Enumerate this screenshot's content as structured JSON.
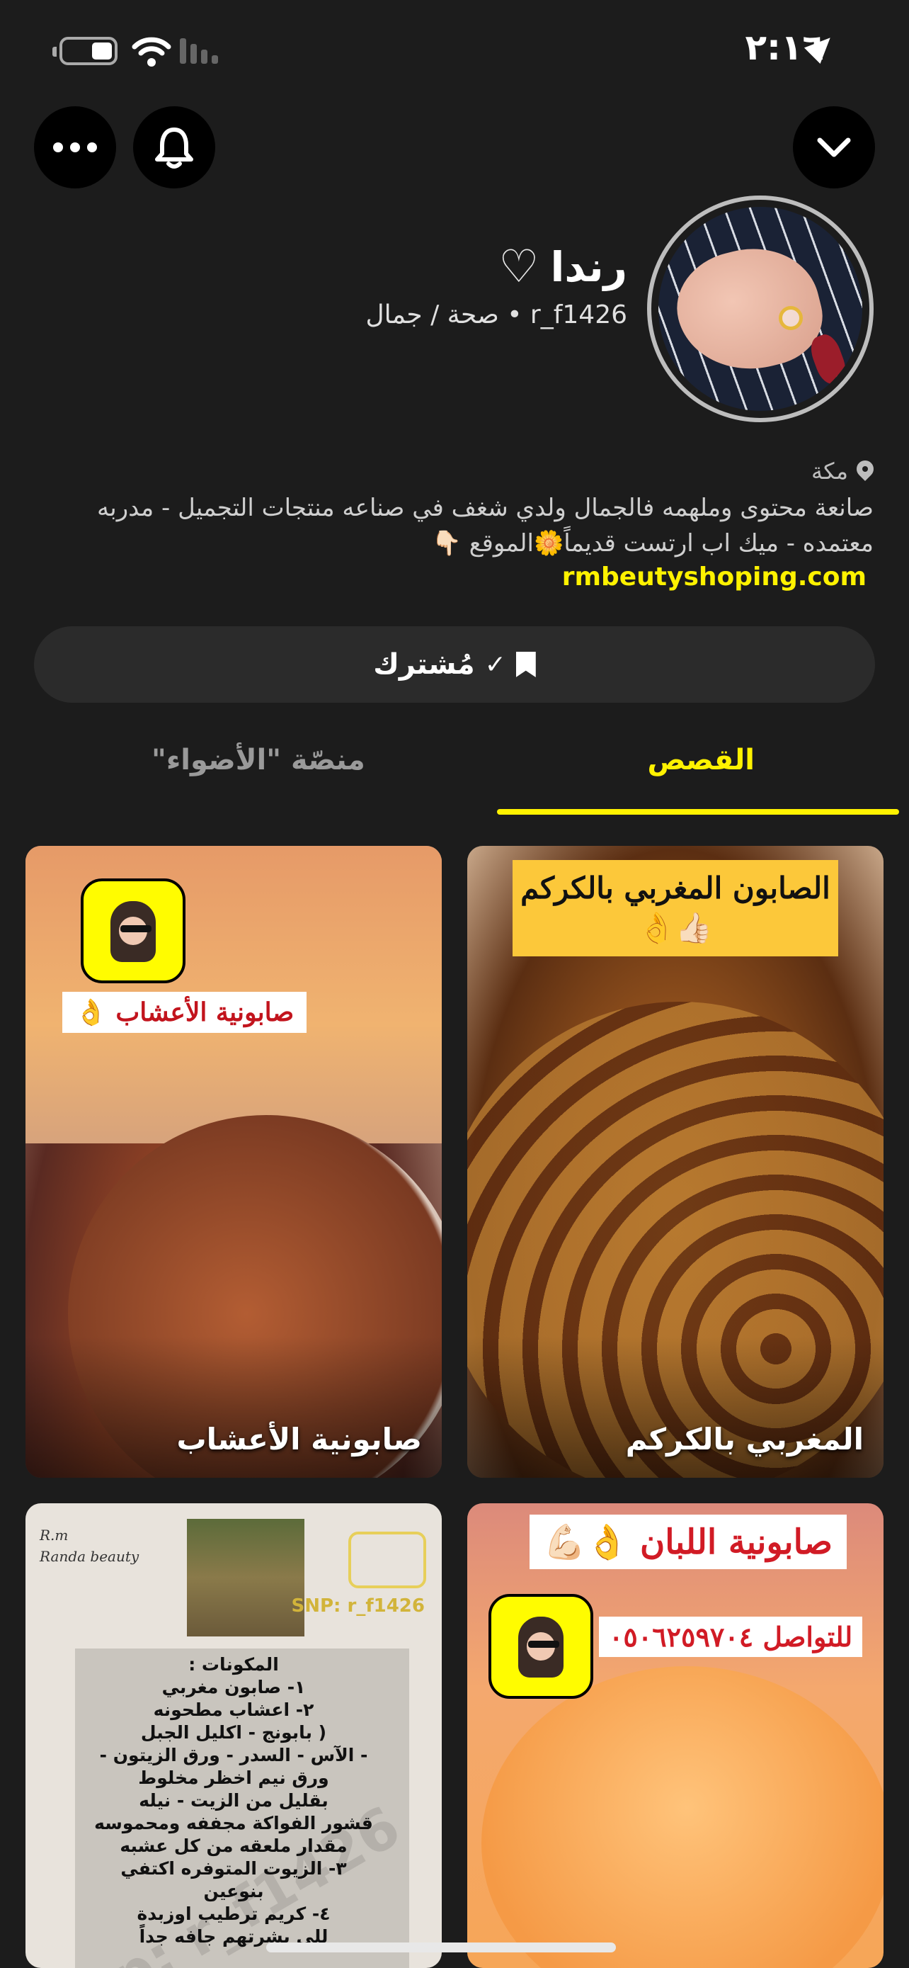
{
  "status_bar": {
    "time": "٢:١٦",
    "icons": [
      "location-arrow-icon",
      "battery-icon",
      "wifi-icon",
      "cellular-signal-icon"
    ]
  },
  "top_bar": {
    "icons": [
      "more-icon",
      "bell-icon",
      "chevron-down-icon"
    ]
  },
  "profile": {
    "name": "رندا",
    "name_emoji": "♡",
    "handle_line": "r_f1426 • صحة / جمال",
    "location": "مكة",
    "bio": "صانعة محتوى وملهمه فالجمال ولدي شغف في صناعه منتجات التجميل - مدربه معتمده - ميك اب ارتست قديماً🌼الموقع 👇🏻",
    "website": "rmbeutyshoping.com",
    "subscribe_label": "مُشترك",
    "subscribe_check": "✓"
  },
  "tabs": [
    {
      "label": "القصص",
      "active": true
    },
    {
      "label": "منصّة \"الأضواء\"",
      "active": false
    }
  ],
  "stories": [
    {
      "caption": "صابونية الأعشاب",
      "overlay_label": "صابونية الأعشاب 👌"
    },
    {
      "caption": "المغربي بالكركم",
      "overlay_label": "الصابون المغربي بالكركم 👍🏻👌"
    },
    {
      "logo_line1": "R.m",
      "logo_line2": "Randa beauty",
      "snap_label": "SNP: r_f1426",
      "recipe_lines": [
        "المكونات :",
        "١- صابون مغربي",
        "٢- اعشاب مطحونه",
        "( بابونج - اكليل الجبل",
        "- الآس - السدر - ورق الزيتون -",
        "ورق نيم اخظر مخلوط",
        "بقليل من الزيت - نيله",
        "قشور الفواكة مجففه ومحموسه",
        "مقدار ملعقه من كل عشبه",
        "٣- الزيوت المتوفره اكتفي",
        "بنوعين",
        "٤- كريم ترطيب اوزبدة",
        "للي بشرتهم جافه جداً"
      ],
      "watermark": "snp: r_f1426"
    },
    {
      "title": "صابونية اللبان 👌💪🏻",
      "phone_label": "للتواصل ٠٥٠٦٢٥٩٧٠٤"
    }
  ],
  "colors": {
    "background": "#1c1c1c",
    "accent_yellow": "#fff200",
    "button_bg": "#2b2b2b"
  }
}
